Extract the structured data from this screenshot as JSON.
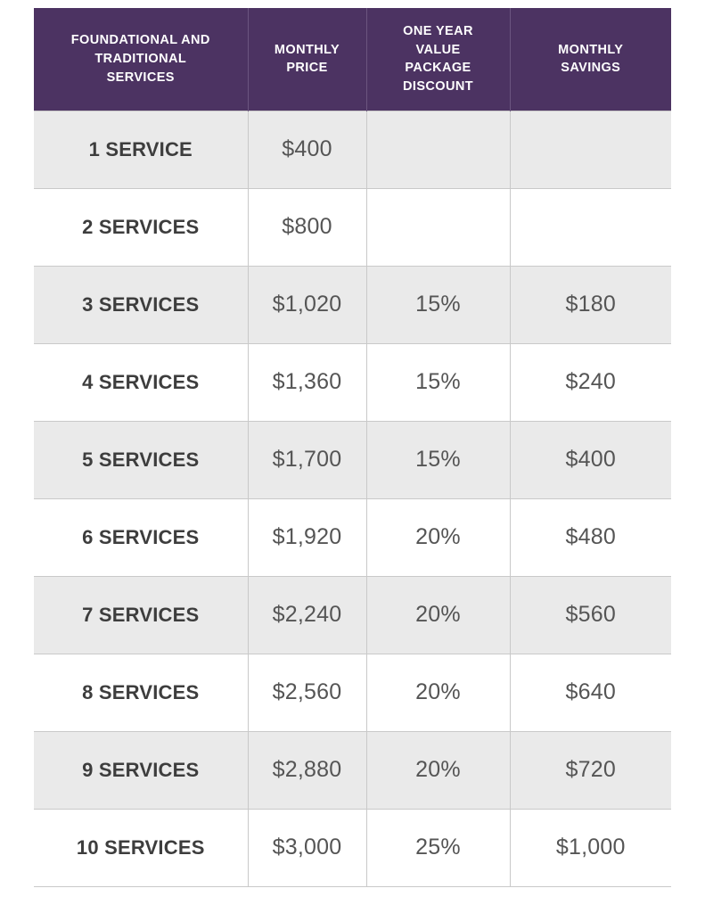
{
  "table": {
    "accent_color": "#4C3362",
    "shaded_row_color": "#EAEAEA",
    "plain_row_color": "#FFFFFF",
    "border_color": "#C9C9C9",
    "header_text_color": "#FFFFFF",
    "service_text_color": "#3D3D3D",
    "value_text_color": "#555555",
    "headers": [
      {
        "lines": [
          "FOUNDATIONAL AND",
          "TRADITIONAL",
          "SERVICES"
        ]
      },
      {
        "lines": [
          "MONTHLY",
          "PRICE"
        ]
      },
      {
        "lines": [
          "ONE YEAR",
          "VALUE",
          "PACKAGE",
          "DISCOUNT"
        ]
      },
      {
        "lines": [
          "MONTHLY",
          "SAVINGS"
        ]
      }
    ],
    "rows": [
      {
        "service": "1 SERVICE",
        "price": "$400",
        "discount": "",
        "savings": ""
      },
      {
        "service": "2 SERVICES",
        "price": "$800",
        "discount": "",
        "savings": ""
      },
      {
        "service": "3 SERVICES",
        "price": "$1,020",
        "discount": "15%",
        "savings": "$180"
      },
      {
        "service": "4 SERVICES",
        "price": "$1,360",
        "discount": "15%",
        "savings": "$240"
      },
      {
        "service": "5 SERVICES",
        "price": "$1,700",
        "discount": "15%",
        "savings": "$400"
      },
      {
        "service": "6 SERVICES",
        "price": "$1,920",
        "discount": "20%",
        "savings": "$480"
      },
      {
        "service": "7 SERVICES",
        "price": "$2,240",
        "discount": "20%",
        "savings": "$560"
      },
      {
        "service": "8 SERVICES",
        "price": "$2,560",
        "discount": "20%",
        "savings": "$640"
      },
      {
        "service": "9 SERVICES",
        "price": "$2,880",
        "discount": "20%",
        "savings": "$720"
      },
      {
        "service": "10 SERVICES",
        "price": "$3,000",
        "discount": "25%",
        "savings": "$1,000"
      }
    ]
  },
  "chart_data": {
    "type": "table",
    "title": "",
    "columns": [
      "FOUNDATIONAL AND TRADITIONAL SERVICES",
      "MONTHLY PRICE",
      "ONE YEAR VALUE PACKAGE DISCOUNT",
      "MONTHLY SAVINGS"
    ],
    "rows": [
      [
        "1 SERVICE",
        "$400",
        "",
        ""
      ],
      [
        "2 SERVICES",
        "$800",
        "",
        ""
      ],
      [
        "3 SERVICES",
        "$1,020",
        "15%",
        "$180"
      ],
      [
        "4 SERVICES",
        "$1,360",
        "15%",
        "$240"
      ],
      [
        "5 SERVICES",
        "$1,700",
        "15%",
        "$400"
      ],
      [
        "6 SERVICES",
        "$1,920",
        "20%",
        "$480"
      ],
      [
        "7 SERVICES",
        "$2,240",
        "20%",
        "$560"
      ],
      [
        "8 SERVICES",
        "$2,560",
        "20%",
        "$640"
      ],
      [
        "9 SERVICES",
        "$2,880",
        "20%",
        "$720"
      ],
      [
        "10 SERVICES",
        "$3,000",
        "25%",
        "$1,000"
      ]
    ]
  }
}
